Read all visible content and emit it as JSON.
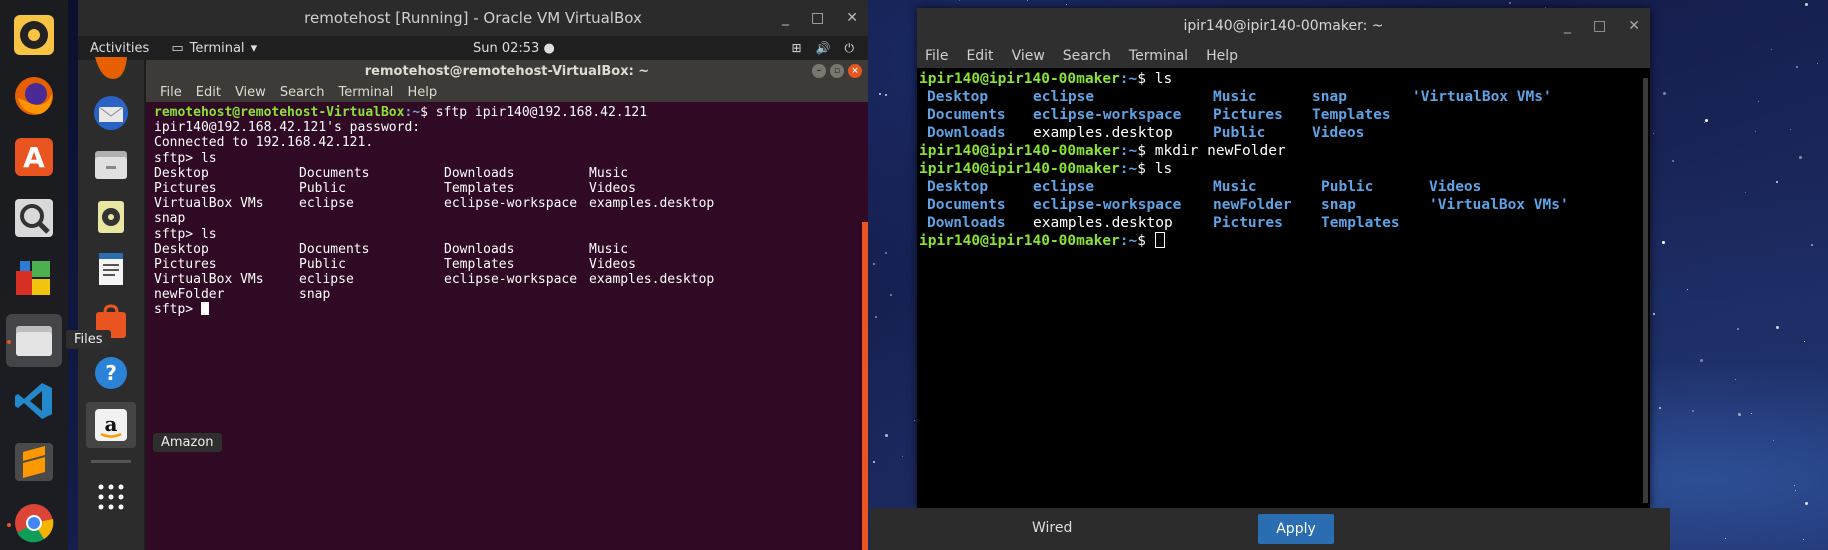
{
  "vbox": {
    "title": "remotehost [Running] - Oracle VM VirtualBox",
    "controls": [
      "_",
      "□",
      "✕"
    ]
  },
  "guest_topbar": {
    "activities": "Activities",
    "app": "Terminal",
    "clock": "Sun 02:53",
    "tray": [
      "⊞",
      "🔊",
      "⏻"
    ]
  },
  "guest_terminal": {
    "title": "remotehost@remotehost-VirtualBox: ~",
    "menu": [
      "File",
      "Edit",
      "View",
      "Search",
      "Terminal",
      "Help"
    ],
    "prompt_user": "remotehost@remotehost-VirtualBox",
    "prompt_path": ":~",
    "prompt_symbol": "$ ",
    "command": "sftp ipir140@192.168.42.121",
    "password_line": "ipir140@192.168.42.121's password:",
    "connected_line": "Connected to 192.168.42.121.",
    "sftp_prompt": "sftp> ",
    "ls_cmd": "ls",
    "listing1": [
      [
        "Desktop",
        "Documents",
        "Downloads",
        "Music"
      ],
      [
        "Pictures",
        "Public",
        "Templates",
        "Videos"
      ],
      [
        "VirtualBox VMs",
        "eclipse",
        "eclipse-workspace",
        "examples.desktop"
      ],
      [
        "snap",
        "",
        "",
        ""
      ]
    ],
    "listing2": [
      [
        "Desktop",
        "Documents",
        "Downloads",
        "Music"
      ],
      [
        "Pictures",
        "Public",
        "Templates",
        "Videos"
      ],
      [
        "VirtualBox VMs",
        "eclipse",
        "eclipse-workspace",
        "examples.desktop"
      ],
      [
        "newFolder",
        "snap",
        "",
        ""
      ]
    ]
  },
  "tooltips": {
    "files": "Files",
    "amazon": "Amazon"
  },
  "host_terminal": {
    "title": "ipir140@ipir140-00maker: ~",
    "controls": [
      "_",
      "□",
      "✕"
    ],
    "menu": [
      "File",
      "Edit",
      "View",
      "Search",
      "Terminal",
      "Help"
    ],
    "prompt_user": "ipir140@ipir140-00maker",
    "prompt_path": ":~",
    "prompt_symbol": "$ ",
    "cmd_ls": "ls",
    "cmd_mkdir": "mkdir newFolder",
    "listing1": [
      [
        "Desktop",
        "eclipse",
        "Music",
        "snap",
        "'VirtualBox VMs'"
      ],
      [
        "Documents",
        "eclipse-workspace",
        "Pictures",
        "Templates",
        ""
      ],
      [
        "Downloads",
        "examples.desktop",
        "Public",
        "Videos",
        ""
      ]
    ],
    "listing2": [
      [
        "Desktop",
        "eclipse",
        "Music",
        "Public",
        "Videos"
      ],
      [
        "Documents",
        "eclipse-workspace",
        "newFolder",
        "snap",
        "'VirtualBox VMs'"
      ],
      [
        "Downloads",
        "examples.desktop",
        "Pictures",
        "Templates",
        ""
      ]
    ]
  },
  "settings": {
    "wired": "Wired",
    "apply": "Apply"
  }
}
